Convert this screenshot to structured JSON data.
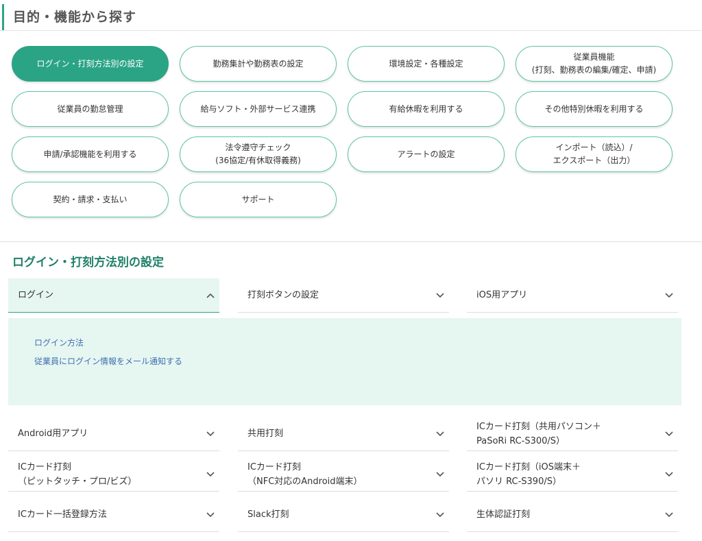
{
  "header": {
    "title": "目的・機能から探す"
  },
  "categories": [
    {
      "label": "ログイン・打刻方法別の設定",
      "active": true
    },
    {
      "label": "勤務集計や勤務表の設定"
    },
    {
      "label": "環境設定・各種設定"
    },
    {
      "label": "従業員機能\n(打刻、勤務表の編集/確定、申請)"
    },
    {
      "label": "従業員の勤怠管理"
    },
    {
      "label": "給与ソフト・外部サービス連携"
    },
    {
      "label": "有給休暇を利用する"
    },
    {
      "label": "その他特別休暇を利用する"
    },
    {
      "label": "申請/承認機能を利用する"
    },
    {
      "label": "法令遵守チェック\n(36協定/有休取得義務)"
    },
    {
      "label": "アラートの設定"
    },
    {
      "label": "インポート（読込）/\nエクスポート（出力）"
    },
    {
      "label": "契約・請求・支払い"
    },
    {
      "label": "サポート"
    }
  ],
  "section": {
    "title": "ログイン・打刻方法別の設定"
  },
  "accordions": [
    {
      "label": "ログイン",
      "open": true
    },
    {
      "label": "打刻ボタンの設定"
    },
    {
      "label": "iOS用アプリ"
    },
    {
      "label": "Android用アプリ"
    },
    {
      "label": "共用打刻"
    },
    {
      "label": "ICカード打刻（共用パソコン＋\nPaSoRi RC-S300/S）"
    },
    {
      "label": "ICカード打刻\n（ピットタッチ・プロ/ビズ）"
    },
    {
      "label": "ICカード打刻\n（NFC対応のAndroid端末）"
    },
    {
      "label": "ICカード打刻（iOS端末＋\nパソリ RC-S390/S）"
    },
    {
      "label": "ICカード一括登録方法"
    },
    {
      "label": "Slack打刻"
    },
    {
      "label": "生体認証打刻"
    }
  ],
  "panel_links": [
    {
      "label": "ログイン方法"
    },
    {
      "label": "従業員にログイン情報をメール通知する"
    }
  ],
  "colors": {
    "accent": "#2ba486",
    "panel_bg": "#e6f6f1",
    "link": "#3f6fb0"
  }
}
